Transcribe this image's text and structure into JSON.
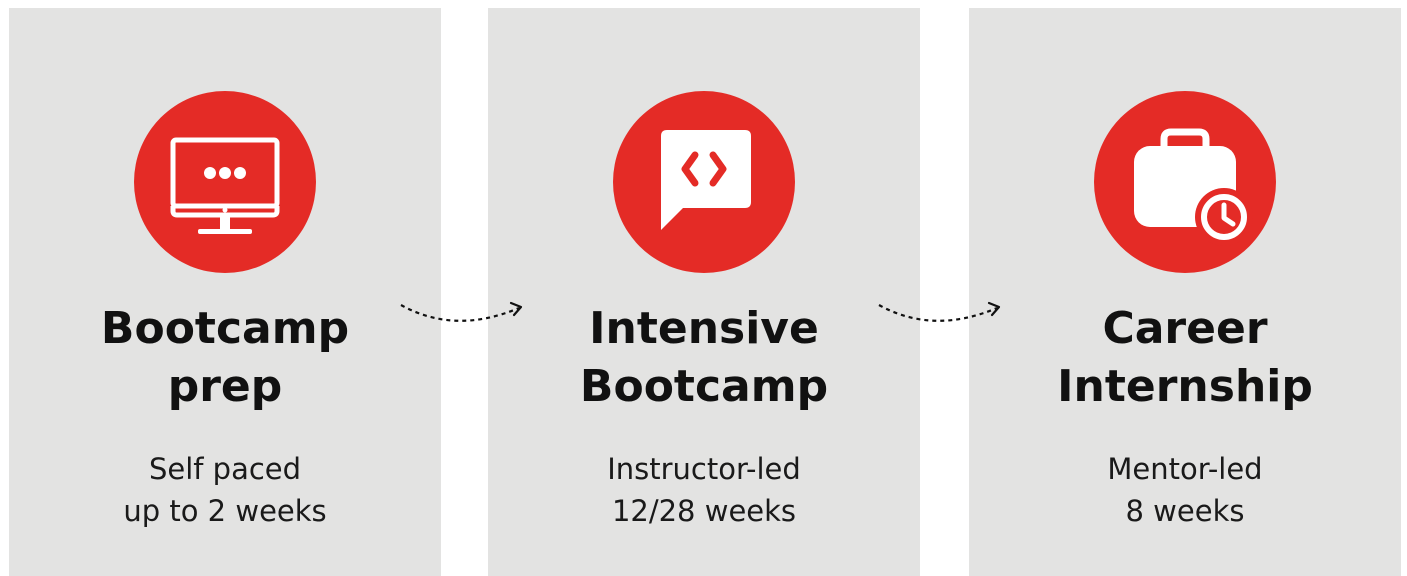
{
  "colors": {
    "card_background": "#e3e3e2",
    "accent_red": "#e42b26",
    "text_dark": "#111111"
  },
  "steps": [
    {
      "icon": "monitor-icon",
      "title_lines": [
        "Bootcamp",
        "prep"
      ],
      "subtitle_lines": [
        "Self paced",
        "up to 2 weeks"
      ]
    },
    {
      "icon": "code-chat-icon",
      "title_lines": [
        "Intensive",
        "Bootcamp"
      ],
      "subtitle_lines": [
        "Instructor-led",
        "12/28 weeks"
      ]
    },
    {
      "icon": "briefcase-clock-icon",
      "title_lines": [
        "Career",
        "Internship"
      ],
      "subtitle_lines": [
        "Mentor-led",
        "8 weeks"
      ]
    }
  ],
  "connectors": [
    "dotted-arrow-icon",
    "dotted-arrow-icon"
  ]
}
